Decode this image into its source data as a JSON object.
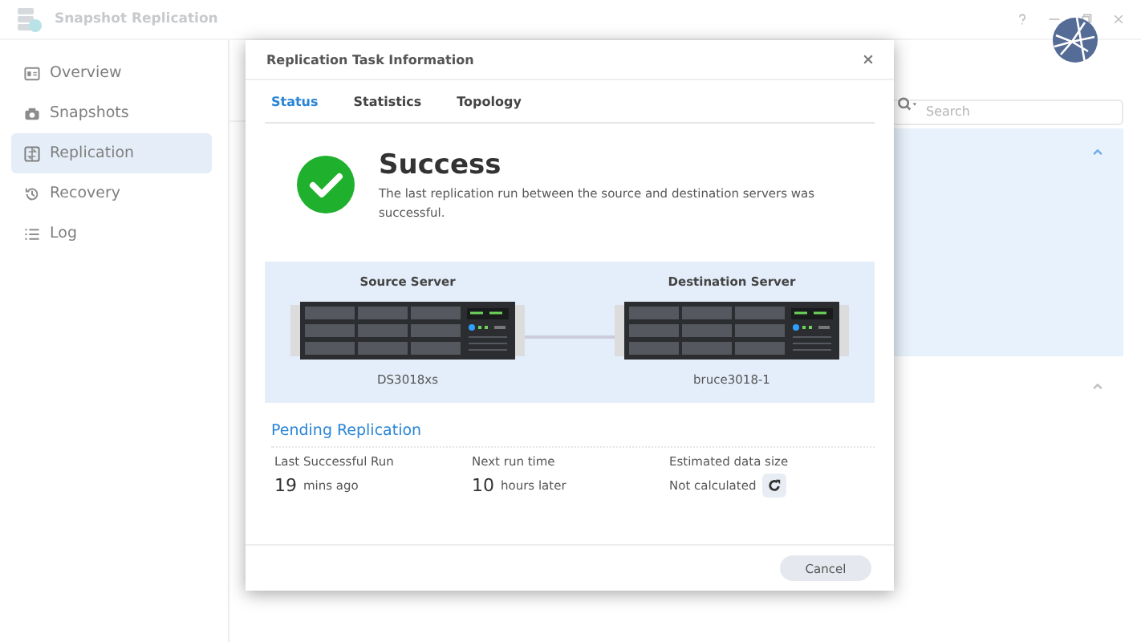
{
  "window": {
    "title": "Snapshot Replication"
  },
  "sidebar": {
    "items": [
      {
        "label": "Overview",
        "selected": false
      },
      {
        "label": "Snapshots",
        "selected": false
      },
      {
        "label": "Replication",
        "selected": true
      },
      {
        "label": "Recovery",
        "selected": false
      },
      {
        "label": "Log",
        "selected": false
      }
    ]
  },
  "search": {
    "placeholder": "Search"
  },
  "panels": [
    {
      "expanded": true,
      "selected": true
    },
    {
      "expanded": true,
      "selected": false
    }
  ],
  "dialog": {
    "title": "Replication Task Information",
    "tabs": [
      {
        "label": "Status",
        "selected": true
      },
      {
        "label": "Statistics",
        "selected": false
      },
      {
        "label": "Topology",
        "selected": false
      }
    ],
    "status": {
      "kind": "success",
      "heading": "Success",
      "message": "The last replication run between the source and destination servers was successful."
    },
    "source": {
      "heading": "Source Server",
      "name": "DS3018xs"
    },
    "destination": {
      "heading": "Destination Server",
      "name": "bruce3018-1"
    },
    "pending": {
      "title": "Pending Replication",
      "items": [
        {
          "label": "Last Successful Run",
          "value": "19",
          "unit": "mins ago"
        },
        {
          "label": "Next run time",
          "value": "10",
          "unit": "hours later"
        },
        {
          "label": "Estimated data size",
          "text": "Not calculated"
        }
      ]
    },
    "buttons": [
      "Cancel"
    ]
  }
}
